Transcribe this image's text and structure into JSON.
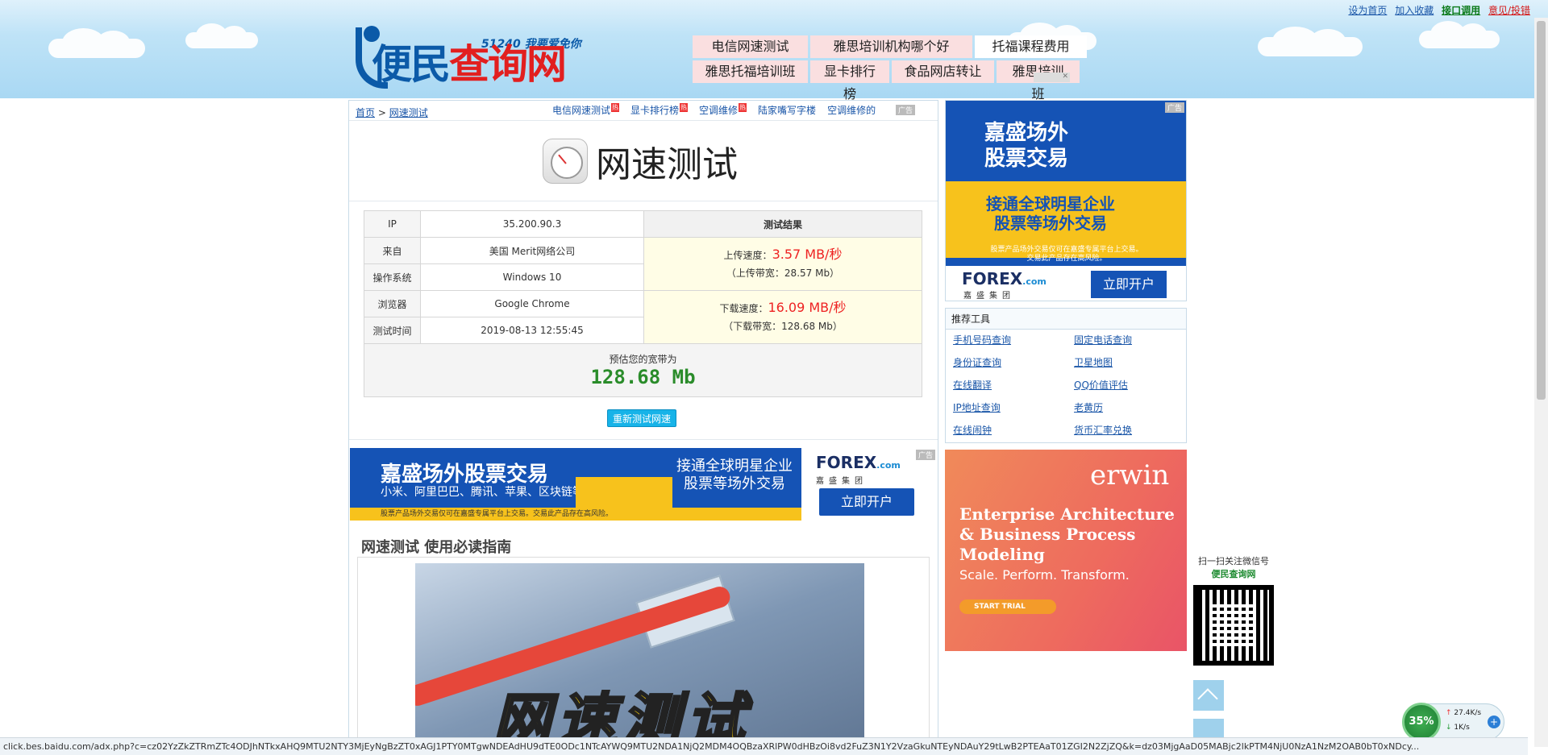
{
  "toplinks": [
    "设为首页",
    "加入收藏",
    "接口调用",
    "意见/投错"
  ],
  "logo": {
    "tagline": "51240 我要爱免你",
    "name_a": "便民",
    "name_b": "查询网"
  },
  "topnav": {
    "row1": [
      "电信网速测试",
      "雅思培训机构哪个好",
      "托福课程费用"
    ],
    "row2": [
      "雅思托福培训班",
      "显卡排行榜",
      "食品网店转让",
      "雅思培训班"
    ]
  },
  "breadcrumb": {
    "home": "首页",
    "sep": " > ",
    "current": "网速测试"
  },
  "quicklinks": [
    {
      "label": "电信网速测试",
      "hot": "热"
    },
    {
      "label": "显卡排行榜",
      "hot": "热"
    },
    {
      "label": "空调维修",
      "hot": "热"
    },
    {
      "label": "陆家嘴写字楼",
      "hot": ""
    },
    {
      "label": "空调维修的",
      "hot": ""
    }
  ],
  "ad_label": "广告",
  "page_title": "网速测试",
  "result": {
    "ip_label": "IP",
    "ip": "35.200.90.3",
    "header": "测试结果",
    "from_label": "来自",
    "from": "美国 Merit网络公司",
    "os_label": "操作系统",
    "os": "Windows 10",
    "browser_label": "浏览器",
    "browser": "Google Chrome",
    "time_label": "测试时间",
    "time": "2019-08-13 12:55:45",
    "upload_label": "上传速度：",
    "upload": "3.57 MB/秒",
    "upload_bw": "（上传带宽：28.57 Mb）",
    "download_label": "下载速度：",
    "download": "16.09 MB/秒",
    "download_bw": "（下载带宽：128.68 Mb）",
    "est_label": "预估您的宽带为",
    "est": "128.68 Mb"
  },
  "retest_button": "重新测试网速",
  "banner": {
    "title": "嘉盛场外股票交易",
    "sub": "小米、阿里巴巴、腾讯、苹果、区块链等",
    "right1": "接通全球明星企业",
    "right2": "股票等场外交易",
    "foot": "股票产品场外交易仅可在嘉盛专属平台上交易。交易此产品存在高风险。",
    "forex": "FOREX",
    "forex_dom": ".com",
    "forex_cn": "嘉盛集团",
    "open": "立即开户"
  },
  "guide_title": "网速测试 使用必读指南",
  "guide_image_text": "网速测试",
  "rightad1": {
    "h1": "嘉盛场外",
    "h2": "股票交易",
    "m1": "接通全球明星企业",
    "m2": "股票等场外交易",
    "disc1": "股票产品场外交易仅可在嘉盛专属平台上交易。",
    "disc2": "交易此产品存在高风险。",
    "forex": "FOREX",
    "forex_dom": ".com",
    "cn": "嘉盛集团",
    "open": "立即开户"
  },
  "tools": {
    "title": "推荐工具",
    "items": [
      "手机号码查询",
      "固定电话查询",
      "身份证查询",
      "卫星地图",
      "在线翻译",
      "QQ价值评估",
      "IP地址查询",
      "老黄历",
      "在线闹钟",
      "货币汇率兑换"
    ]
  },
  "rightad2": {
    "brand": "erwin",
    "l1": "Enterprise Architecture",
    "l2": "& Business Process",
    "l3": "Modeling",
    "tag": "Scale. Perform. Transform.",
    "cta": "START TRIAL"
  },
  "qr": {
    "l1": "扫一扫关注微信号",
    "l2": "便民查询网"
  },
  "statusbar": "click.bes.baidu.com/adx.php?c=cz02YzZkZTRmZTc4ODJhNTkxAHQ9MTU2NTY3MjEyNgBzZT0xAGJ1PTY0MTgwNDEAdHU9dTE0ODc1NTcAYWQ9MTU2NDA1NjQ2MDM4OQBzaXRlPW0dHBzOi8vd2FuZ3N1Y2VzaGkuNTEyNDAuY29tLwB2PTEAaT01ZGI2N2ZjZQ&k=dz03MjgAaD05MABjc2lkPTM4NjU0NzA1NzM2OAB0bT0xNDcy...",
  "speedwidget": {
    "pct": "35%",
    "up": "27.4K/s",
    "down": "1K/s"
  },
  "colors": {
    "accent": "#17b3e8",
    "red": "#e22222",
    "green": "#2a8c2a",
    "link": "#1a56a8"
  }
}
